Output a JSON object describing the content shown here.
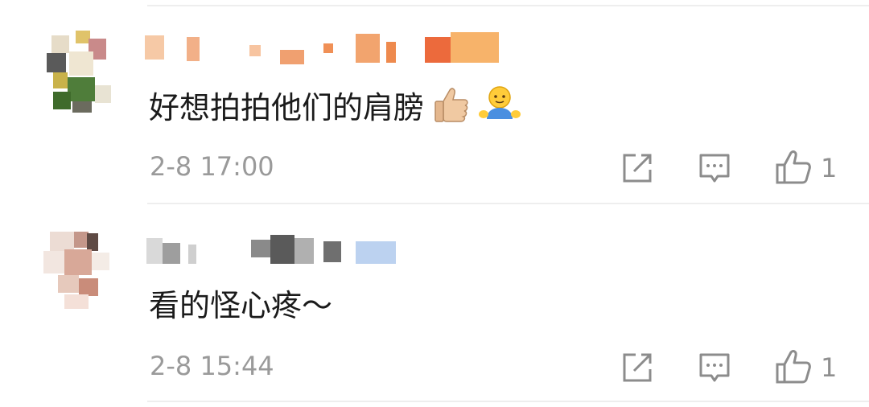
{
  "comments": [
    {
      "text": "好想拍拍他们的肩膀",
      "emojis": [
        "thumbs-up-emoji",
        "shoulder-pat-emoji"
      ],
      "time": "2-8 17:00",
      "likes": "1"
    },
    {
      "text": "看的怪心疼～",
      "emojis": [],
      "time": "2-8 15:44",
      "likes": "1"
    }
  ],
  "icons": {
    "share": "share-icon",
    "reply": "comment-icon",
    "like": "like-icon"
  },
  "colors": {
    "text": "#1b1b1b",
    "meta": "#9a9a9a",
    "icon": "#8c8c8c",
    "divider": "#eeeeee"
  }
}
